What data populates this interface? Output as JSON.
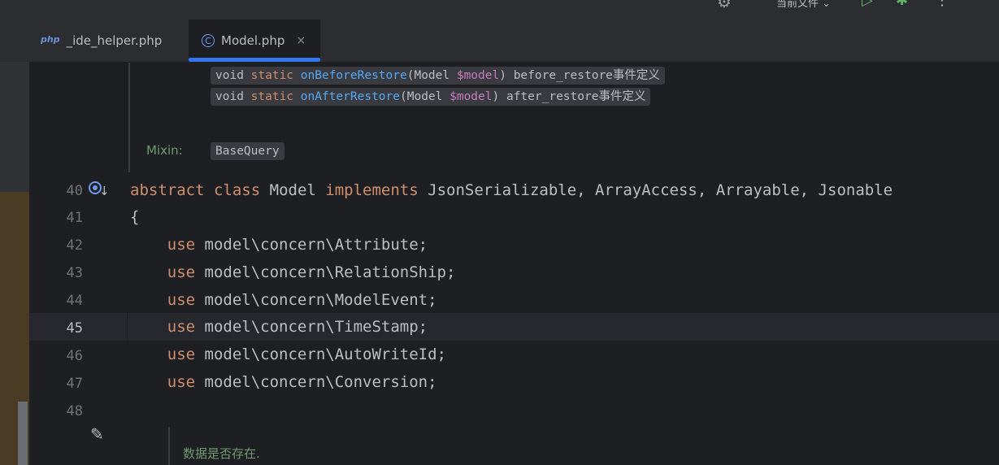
{
  "toolbar": {
    "file_scope_label": "当前文件 ⌄"
  },
  "tabs": [
    {
      "icon": "php-file-icon",
      "label": "_ide_helper.php"
    },
    {
      "icon": "class-icon",
      "label": "Model.php",
      "close": "×"
    }
  ],
  "doc": {
    "lines": [
      {
        "void": "void",
        "static": "static",
        "fn": "onBeforeRestore",
        "open": "(Model ",
        "var": "$model",
        "rest": ") before_restore事件定义"
      },
      {
        "void": "void",
        "static": "static",
        "fn": "onAfterRestore",
        "open": "(Model ",
        "var": "$model",
        "rest": ") after_restore事件定义"
      }
    ],
    "mixin_label": "Mixin:",
    "mixin_value": "BaseQuery"
  },
  "code": {
    "line_numbers": [
      "40",
      "41",
      "42",
      "43",
      "44",
      "45",
      "46",
      "47",
      "48"
    ],
    "active_line": "45",
    "line40": {
      "kw1": "abstract",
      "kw2": "class",
      "name": "Model",
      "kw3": "implements",
      "rest": "JsonSerializable, ArrayAccess, Arrayable, Jsonable"
    },
    "line41": "{",
    "use_keyword": "use",
    "uses": [
      "model\\concern\\Attribute;",
      "model\\concern\\RelationShip;",
      "model\\concern\\ModelEvent;",
      "model\\concern\\TimeStamp;",
      "model\\concern\\AutoWriteId;",
      "model\\concern\\Conversion;"
    ],
    "comment": "数据是否存在."
  }
}
